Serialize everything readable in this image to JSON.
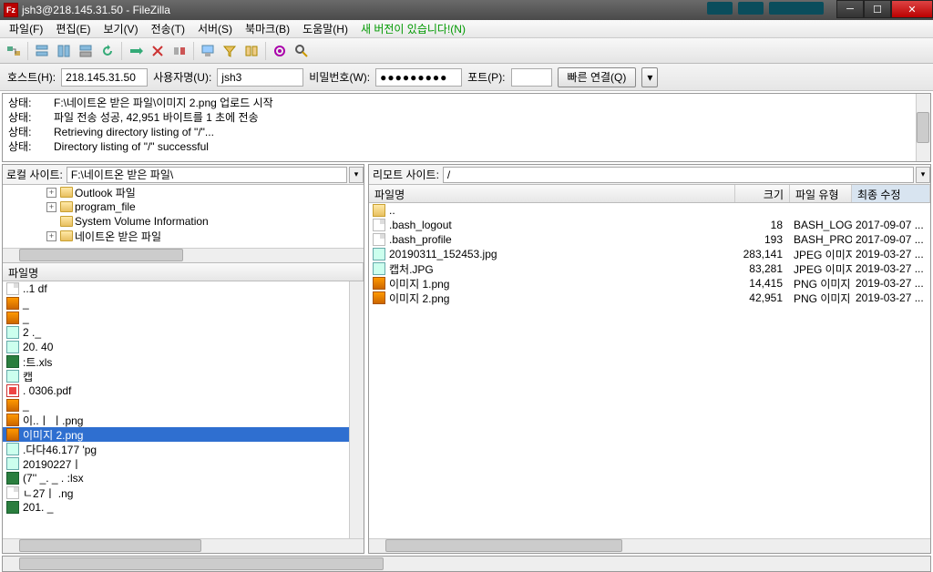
{
  "window": {
    "title": "jsh3@218.145.31.50 - FileZilla"
  },
  "menu": {
    "file": "파일(F)",
    "edit": "편집(E)",
    "view": "보기(V)",
    "transfer": "전송(T)",
    "server": "서버(S)",
    "bookmarks": "북마크(B)",
    "help": "도움말(H)",
    "update": "새 버전이 있습니다!(N)"
  },
  "conn": {
    "hostLabel": "호스트(H):",
    "host": "218.145.31.50",
    "userLabel": "사용자명(U):",
    "user": "jsh3",
    "passLabel": "비밀번호(W):",
    "pass": "●●●●●●●●●",
    "portLabel": "포트(P):",
    "port": "",
    "quick": "빠른 연결(Q)"
  },
  "log": {
    "stateLabel": "상태:",
    "r1": "F:\\네이트온 받은 파일\\이미지 2.png 업로드 시작",
    "r2": "파일 전송 성공, 42,951 바이트를 1 초에 전송",
    "r3": "Retrieving directory listing of \"/\"...",
    "r4": "Directory listing of \"/\" successful"
  },
  "local": {
    "label": "로컬 사이트:",
    "path": "F:\\네이트온 받은 파일\\",
    "tree": [
      "Outlook 파일",
      "program_file",
      "System Volume Information",
      "네이트온 받은 파일"
    ],
    "hdr": "파일명",
    "files": [
      {
        "ico": "txt",
        "name": "..1                            df"
      },
      {
        "ico": "img",
        "name": "_"
      },
      {
        "ico": "img",
        "name": "_"
      },
      {
        "ico": "jpg",
        "name": "2      ._"
      },
      {
        "ico": "jpg",
        "name": "20.        40"
      },
      {
        "ico": "xls",
        "name": "                                :트.xls"
      },
      {
        "ico": "jpg",
        "name": "캡"
      },
      {
        "ico": "pdf",
        "name": ".          0306.pdf"
      },
      {
        "ico": "img",
        "name": "_"
      },
      {
        "ico": "img",
        "name": "이..ㅣ ㅣ.png"
      },
      {
        "ico": "img",
        "name": "이미지 2.png",
        "sel": true
      },
      {
        "ico": "jpg",
        "name": "          .다다46.177 'pg"
      },
      {
        "ico": "jpg",
        "name": "20190227ㅣ"
      },
      {
        "ico": "xls",
        "name": "(7''                     _. _                    .    :lsx"
      },
      {
        "ico": "txt",
        "name": "   ㄴ27ㅣ        .ng"
      },
      {
        "ico": "xls",
        "name": "201. _"
      }
    ]
  },
  "remote": {
    "label": "리모트 사이트:",
    "path": "/",
    "hdr": {
      "name": "파일명",
      "size": "크기",
      "type": "파일 유형",
      "mod": "최종 수정"
    },
    "files": [
      {
        "ico": "up",
        "name": "..",
        "size": "",
        "type": "",
        "mod": ""
      },
      {
        "ico": "txt",
        "name": ".bash_logout",
        "size": "18",
        "type": "BASH_LOG...",
        "mod": "2017-09-07 ..."
      },
      {
        "ico": "txt",
        "name": ".bash_profile",
        "size": "193",
        "type": "BASH_PRO...",
        "mod": "2017-09-07 ..."
      },
      {
        "ico": "jpg",
        "name": "20190311_152453.jpg",
        "size": "283,141",
        "type": "JPEG 이미지",
        "mod": "2019-03-27 ..."
      },
      {
        "ico": "jpg",
        "name": "캡처.JPG",
        "size": "83,281",
        "type": "JPEG 이미지",
        "mod": "2019-03-27 ..."
      },
      {
        "ico": "img",
        "name": "이미지 1.png",
        "size": "14,415",
        "type": "PNG 이미지",
        "mod": "2019-03-27 ..."
      },
      {
        "ico": "img",
        "name": "이미지 2.png",
        "size": "42,951",
        "type": "PNG 이미지",
        "mod": "2019-03-27 ..."
      }
    ]
  }
}
